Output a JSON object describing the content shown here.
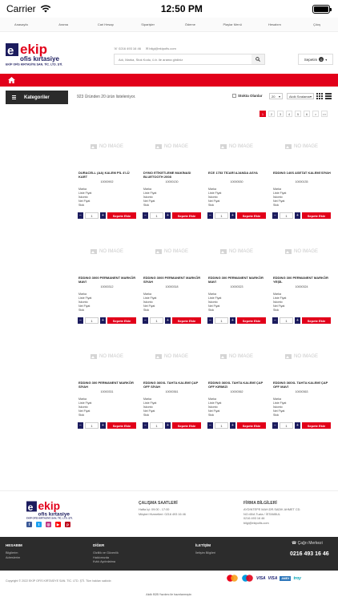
{
  "status_bar": {
    "carrier": "Carrier",
    "time": "12:50 PM"
  },
  "top_nav": [
    "Anasayfa",
    "Arama",
    "Cari Hesap",
    "Siparişler",
    "Ödeme",
    "Playlar Menü",
    "Hesabım",
    "Çıkış"
  ],
  "brand": {
    "name": "ekip",
    "sub": "ofis kırtasiye",
    "legal": "EKİP OFİS KIRTASİYE SAN. TİC. LTD. ŞTİ.",
    "red": "#e2001a",
    "blue": "#1c1c5e"
  },
  "contact": {
    "phone": "0216 493 16 46",
    "email": "bilgi@ekipofis.com"
  },
  "search": {
    "placeholder": "Adı, Marka, Stok Kodu, ü.b. ile arama girdiniz"
  },
  "cart": {
    "label": "Sepetim",
    "count": "0"
  },
  "toolbar": {
    "categories_label": "Kategoriler",
    "list_info": "923 Üründen 20 ürün listeleniyor.",
    "stock_label": "Stokta Olanlar",
    "page_size": "20",
    "sort": "Akıllı Sıralama"
  },
  "pagination": [
    "1",
    "2",
    "3",
    "4",
    "5",
    "6",
    ">",
    ">>"
  ],
  "no_image_text": "NO IMAGE",
  "attr_labels": [
    "Marka",
    "Liste Fiyat",
    "İskonto",
    "Net Fiyat",
    "Stok"
  ],
  "add_to_cart": "Sepete Ekle",
  "qty_default": "1",
  "products": [
    {
      "name": "DURACELL (AA) KALEM PİL 4'LÜ KART",
      "code": "10000902"
    },
    {
      "name": "DYMO ETİKETLEME MAKİNASI BLUETOOTH 2008",
      "code": "10000130"
    },
    {
      "name": "ECE 1753 TİCARİ AJANDA ASYA",
      "code": "10000530"
    },
    {
      "name": "EDDING 140S ASETAT KALEMİ SİYAH",
      "code": "10000135"
    },
    {
      "name": "EDDING 3000 PERMANENT MARKÖR MAVİ",
      "code": "10000312"
    },
    {
      "name": "EDDING 3000 PERMANENT MARKÖR SİYAH",
      "code": "10000318"
    },
    {
      "name": "EDDING 300 PERMANENT MARKÖR MAVİ",
      "code": "10000323"
    },
    {
      "name": "EDDING 300 PERMANENT MARKÖR YEŞİL",
      "code": "10000324"
    },
    {
      "name": "EDDING 300 PERMANENT MARKÖR SİYAH",
      "code": "10000331"
    },
    {
      "name": "EDDING 360XL TAHTA KALEMİ ÇAP OFF SİYAH",
      "code": "10000361"
    },
    {
      "name": "EDDING 360XL TAHTA KALEMİ ÇAP OFF KIRMIZI",
      "code": "10000362"
    },
    {
      "name": "EDDING 360XL TAHTA KALEMİ ÇAP OFF MAVİ",
      "code": "10000363"
    }
  ],
  "footer": {
    "hours_title": "ÇALIŞMA SAATLERİ",
    "hours_line1": "Hafta İçi: 09:00 - 17:00",
    "hours_line2": "Müşteri Hizmetleri: 0216 493 16 46",
    "firm_title": "FİRMA BİLGİLERİ",
    "firm_line1": "AYDINTEPE MAH.DR.SADIK AHMET CD.",
    "firm_line2": "NO:45/A Tuzla / İSTANBUL",
    "firm_line3": "0216 493 16 46",
    "firm_line4": "bilgi@ekipofis.com",
    "account_title": "HESABIM",
    "account_links": [
      "Bilgilerim",
      "Adreslerim"
    ],
    "other_title": "DİĞER",
    "other_links": [
      "Gizlilik ve Güvenlik",
      "Hakkımızda",
      "Kvkk Aydınlatma"
    ],
    "contact_title": "İLETİŞİM",
    "contact_links": [
      "İletişim Bilgileri"
    ],
    "call_center": "Çağrı Merkezi",
    "phone": "0216 493 16 46",
    "copyright": "Copyright © 2022 EKİP OFİS KIRTASİYE SAN. TİC. LTD. ŞTİ. Tüm hakları saklıdır.",
    "credit": "Akıllı B2B Yazılımı ile hazırlanmıştır.",
    "payments": [
      "MasterCard",
      "Maestro",
      "VISA",
      "VISA",
      "AMEX",
      "troy"
    ]
  }
}
